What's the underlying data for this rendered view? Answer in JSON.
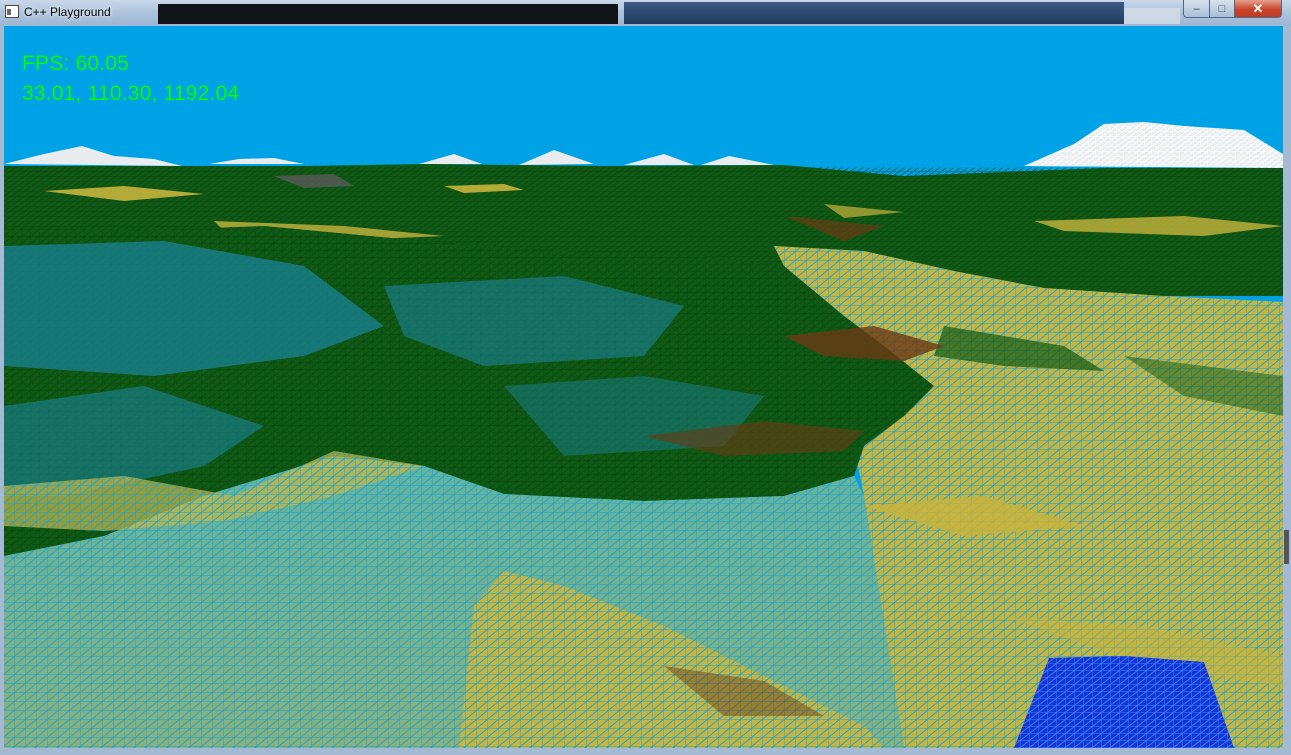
{
  "window": {
    "title": "C++ Playground",
    "controls": {
      "minimize": "–",
      "maximize": "□",
      "close": "✕"
    }
  },
  "hud": {
    "fps_label": "FPS: 60.05",
    "camera_position": "33.01, 110.30, 1192.04"
  },
  "scene": {
    "sky_color": "#00a2e6",
    "grass_color": "#0f5a14",
    "sand_color": "#c8b43c",
    "dirt_color": "#6a3a14",
    "snow_color": "#f2f2f2",
    "water_color": "#1436d2",
    "render_mode": "wireframe"
  },
  "icons": {
    "app": "console-window-icon"
  }
}
